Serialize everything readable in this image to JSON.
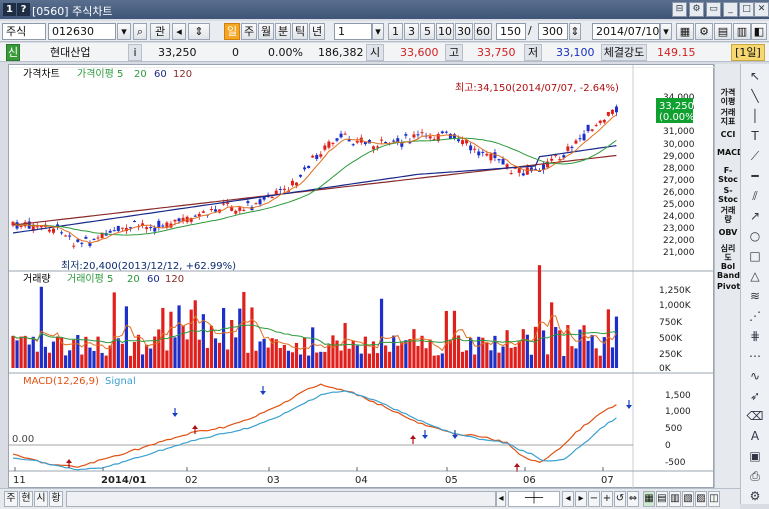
{
  "window": {
    "title": "[0560] 주식차트",
    "icon1": "1",
    "icon2": "?"
  },
  "toolbar_row": {
    "market": "주식",
    "code": "012630",
    "watch_label": "관",
    "period_buttons": [
      "일",
      "주",
      "월",
      "분",
      "틱",
      "년"
    ],
    "interval_value": "1",
    "minute_buttons": [
      "1",
      "3",
      "5",
      "10",
      "30",
      "60"
    ],
    "count_value": "150",
    "range_separator": "/",
    "range_value": "300",
    "date_value": "2014/07/10"
  },
  "quote_row": {
    "badge": "신",
    "name": "현대산업",
    "info_icon": "i",
    "price": "33,250",
    "change": "0",
    "change_pct": "0.00%",
    "volume": "186,382",
    "open_label": "시",
    "open": "33,600",
    "high_label": "고",
    "high": "33,750",
    "low_label": "저",
    "low": "33,100",
    "strength_label": "체결강도",
    "strength": "149.15",
    "period_tag": "[1일]"
  },
  "price_panel": {
    "legend": [
      "가격차트",
      "가격이평 5",
      "20",
      "60",
      "120"
    ],
    "max_note": "최고:34,150(2014/07/07, -2.64%)",
    "min_note": "최저:20,400(2013/12/12, +62.99%)",
    "current_price": "33,250",
    "current_pct": "(0.00%)",
    "y_ticks": [
      "34,000",
      "33,000",
      "31,000",
      "30,000",
      "29,000",
      "28,000",
      "27,000",
      "26,000",
      "25,000",
      "24,000",
      "23,000",
      "22,000",
      "21,000"
    ]
  },
  "volume_panel": {
    "legend": [
      "거래량",
      "거래이평 5",
      "20",
      "60",
      "120"
    ],
    "y_ticks": [
      "1,250K",
      "1,000K",
      "750K",
      "500K",
      "250K",
      "0K"
    ]
  },
  "macd_panel": {
    "legend": [
      "MACD(12,26,9)",
      "Signal"
    ],
    "zero_label": "0.00",
    "y_ticks": [
      "1,500",
      "1,000",
      "500",
      "0",
      "-500"
    ]
  },
  "x_axis": [
    "11",
    "2014/01",
    "02",
    "03",
    "04",
    "05",
    "06",
    "07"
  ],
  "indicator_sidebar": [
    "가격이평",
    "거래지표",
    "CCI",
    "MACD",
    "F-Stoc",
    "S-Stoc",
    "거래량",
    "OBV",
    "심리도",
    "Bol Band",
    "Pivot"
  ],
  "bottom_bar": [
    "주",
    "현",
    "시",
    "황"
  ],
  "colors": {
    "up": "#e0201c",
    "down": "#1e2ec8",
    "ma5": "#e07020",
    "ma20": "#2a9a3a",
    "ma60": "#1a2a8a",
    "ma120": "#8a2a2a",
    "macd": "#e05010",
    "signal": "#3aa0d0"
  }
}
